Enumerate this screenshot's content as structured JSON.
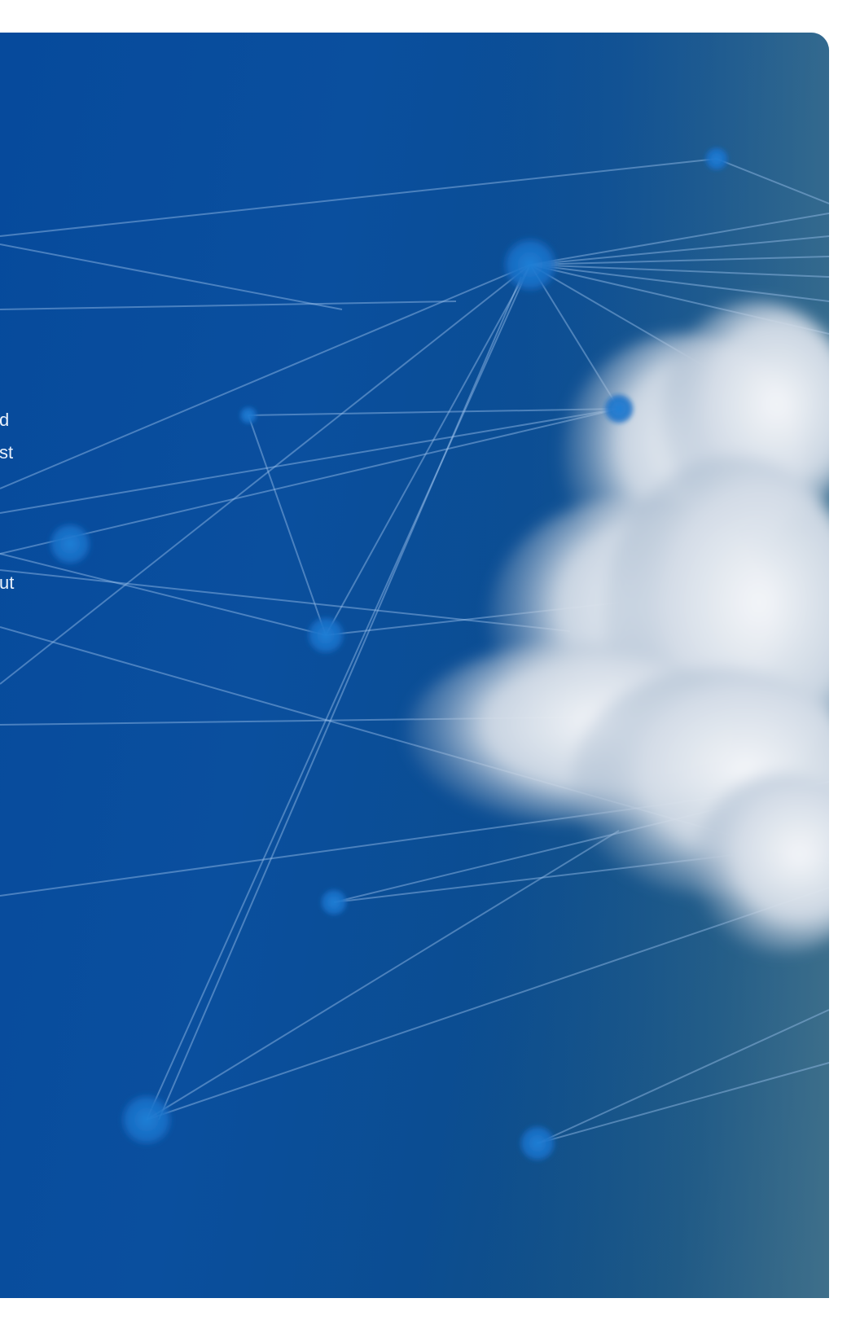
{
  "hero": {
    "text_fragments": [
      "d",
      "st",
      "ut"
    ],
    "colors": {
      "background_start": "#064a9c",
      "background_end": "#2e5e78",
      "network_line": "#8fb6e6",
      "network_node": "#1976d2",
      "cloud": "#e6edf5"
    }
  }
}
